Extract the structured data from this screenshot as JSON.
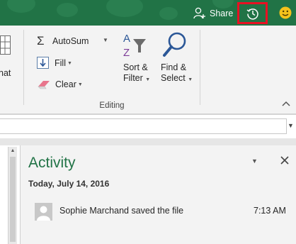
{
  "header": {
    "share_label": "Share"
  },
  "ribbon": {
    "autosum_label": "AutoSum",
    "fill_label": "Fill",
    "clear_label": "Clear",
    "sort_filter_label_1": "Sort &",
    "sort_filter_label_2": "Filter",
    "find_select_label_1": "Find &",
    "find_select_label_2": "Select",
    "group_label": "Editing",
    "format_label_fragment": "nat"
  },
  "activity": {
    "title": "Activity",
    "date_heading": "Today, July 14, 2016",
    "entries": [
      {
        "text": "Sophie Marchand saved the file",
        "time": "7:13 AM"
      }
    ]
  },
  "colors": {
    "title_bar": "#217346",
    "highlight": "#e81123",
    "accent": "#217346"
  }
}
